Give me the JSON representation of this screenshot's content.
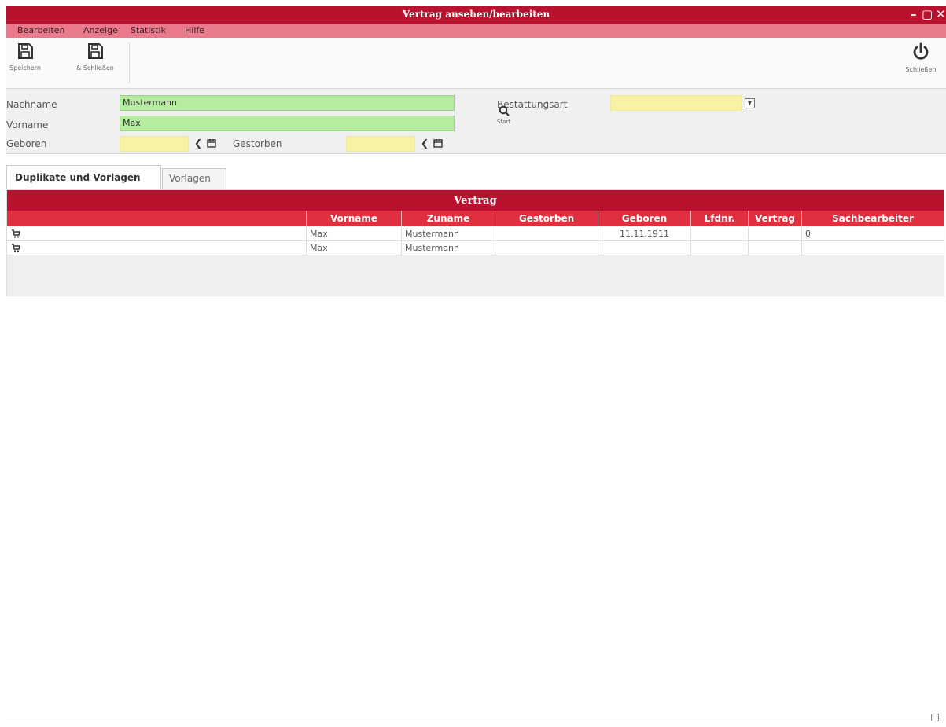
{
  "window": {
    "title": "Vertrag ansehen/bearbeiten",
    "min": "–",
    "max": "▢",
    "close": "✕"
  },
  "menu": [
    "Bearbeiten",
    "Anzeige",
    "Statistik",
    "Hilfe"
  ],
  "toolbar": {
    "save_label": "Speichern",
    "save_close_label": "& Schließen",
    "close_label": "Schließen"
  },
  "search": {
    "nachname_label": "Nachname",
    "nachname_value": "Mustermann",
    "vorname_label": "Vorname",
    "vorname_value": "Max",
    "geboren_label": "Geboren",
    "geboren_value": "",
    "gestorben_label": "Gestorben",
    "gestorben_value": "",
    "bestattungsart_label": "Bestattungsart",
    "bestattungsart_value": "",
    "start_label": "Start"
  },
  "tabs": [
    "Duplikate und Vorlagen",
    "Vorlagen"
  ],
  "grid": {
    "title": "Vertrag",
    "columns": [
      "",
      "Vorname",
      "Zuname",
      "Gestorben",
      "Geboren",
      "Lfdnr.",
      "Vertrag",
      "Sachbearbeiter"
    ],
    "rows": [
      [
        "",
        "Max",
        "Mustermann",
        "",
        "11.11.1911",
        "",
        "",
        "0"
      ],
      [
        "",
        "Max",
        "Mustermann",
        "",
        "",
        "",
        "",
        ""
      ]
    ]
  },
  "colors": {
    "accent": "#b8122f",
    "menu": "#e87a8b",
    "header": "#e0303f",
    "field_green": "#b5ec9f",
    "field_yellow": "#f7f3a3"
  }
}
